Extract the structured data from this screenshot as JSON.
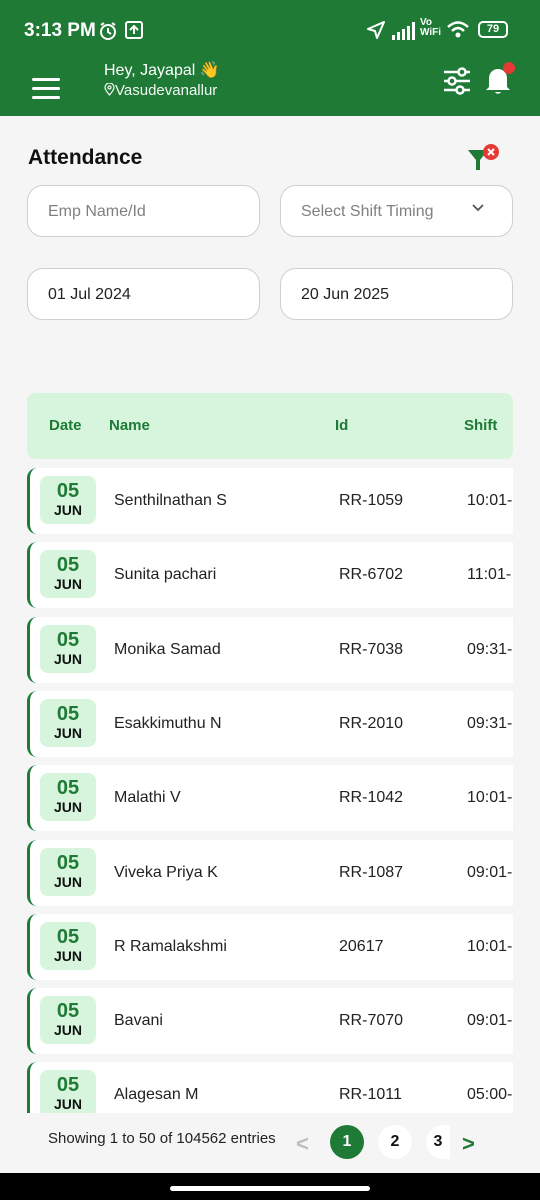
{
  "status_bar": {
    "time": "3:13 PM",
    "battery": "79",
    "vowifi_top": "Vo",
    "vowifi_bottom": "WiFi"
  },
  "header": {
    "greeting": "Hey, Jayapal 👋",
    "location": "Vasudevanallur"
  },
  "page": {
    "title": "Attendance"
  },
  "filters": {
    "emp_placeholder": "Emp Name/Id",
    "shift_placeholder": "Select Shift Timing",
    "from_date": "01 Jul 2024",
    "to_date": "20 Jun 2025"
  },
  "table": {
    "headers": {
      "date": "Date",
      "name": "Name",
      "id": "Id",
      "shift": "Shift"
    },
    "rows": [
      {
        "day": "05",
        "month": "JUN",
        "name": "Senthilnathan S",
        "id": "RR-1059",
        "shift": "10:01-"
      },
      {
        "day": "05",
        "month": "JUN",
        "name": "Sunita pachari",
        "id": "RR-6702",
        "shift": "11:01-"
      },
      {
        "day": "05",
        "month": "JUN",
        "name": "Monika Samad",
        "id": "RR-7038",
        "shift": "09:31-"
      },
      {
        "day": "05",
        "month": "JUN",
        "name": "Esakkimuthu N",
        "id": "RR-2010",
        "shift": "09:31-"
      },
      {
        "day": "05",
        "month": "JUN",
        "name": "Malathi V",
        "id": "RR-1042",
        "shift": "10:01-"
      },
      {
        "day": "05",
        "month": "JUN",
        "name": "Viveka Priya K",
        "id": "RR-1087",
        "shift": "09:01-"
      },
      {
        "day": "05",
        "month": "JUN",
        "name": "R Ramalakshmi",
        "id": "20617",
        "shift": "10:01-"
      },
      {
        "day": "05",
        "month": "JUN",
        "name": "Bavani",
        "id": "RR-7070",
        "shift": "09:01-"
      },
      {
        "day": "05",
        "month": "JUN",
        "name": "Alagesan M",
        "id": "RR-1011",
        "shift": "05:00-"
      }
    ]
  },
  "pagination": {
    "summary": "Showing 1 to 50 of 104562 entries",
    "prev": "<",
    "next": ">",
    "pages": [
      "1",
      "2",
      "3"
    ]
  },
  "colors": {
    "primary": "#1e7a35",
    "light_green": "#d6f5dc",
    "badge_red": "#e53935"
  }
}
